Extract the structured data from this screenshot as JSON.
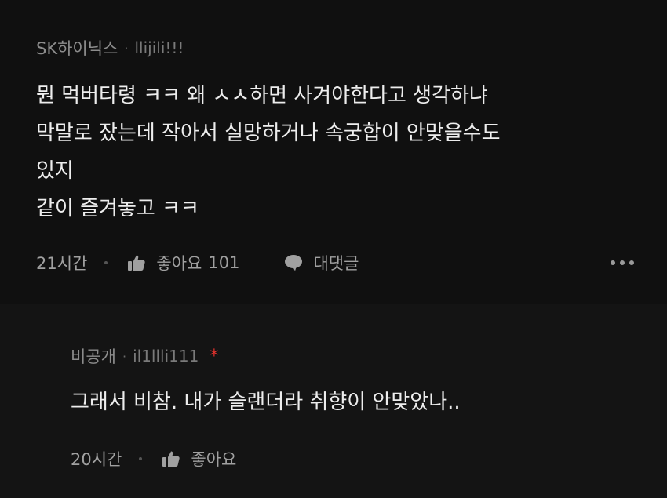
{
  "comments": [
    {
      "author": "SK하이닉스",
      "handle": "llijili!!!",
      "body": "뭔 먹버타령 ㅋㅋ 왜 ㅅㅅ하면 사겨야한다고 생각하냐\n막말로 잤는데 작아서 실망하거나 속궁합이 안맞을수도\n있지\n같이 즐겨놓고 ㅋㅋ",
      "time": "21시간",
      "like_label": "좋아요",
      "like_count": "101",
      "reply_label": "대댓글"
    },
    {
      "author": "비공개",
      "handle": "il1llli111",
      "star": "*",
      "body": "그래서 비참. 내가 슬랜더라 취향이 안맞았나..",
      "time": "20시간",
      "like_label": "좋아요"
    }
  ],
  "separator": "·",
  "icons": {
    "like": "thumbs-up-icon",
    "reply": "speech-bubble-icon",
    "more": "more-dots-icon"
  },
  "colors": {
    "background": "#000000",
    "top_comment_bg": "#101010",
    "reply_bg": "#141414",
    "body_text": "#ededed",
    "meta_text": "#a0a0a0",
    "star": "#e5322d"
  }
}
